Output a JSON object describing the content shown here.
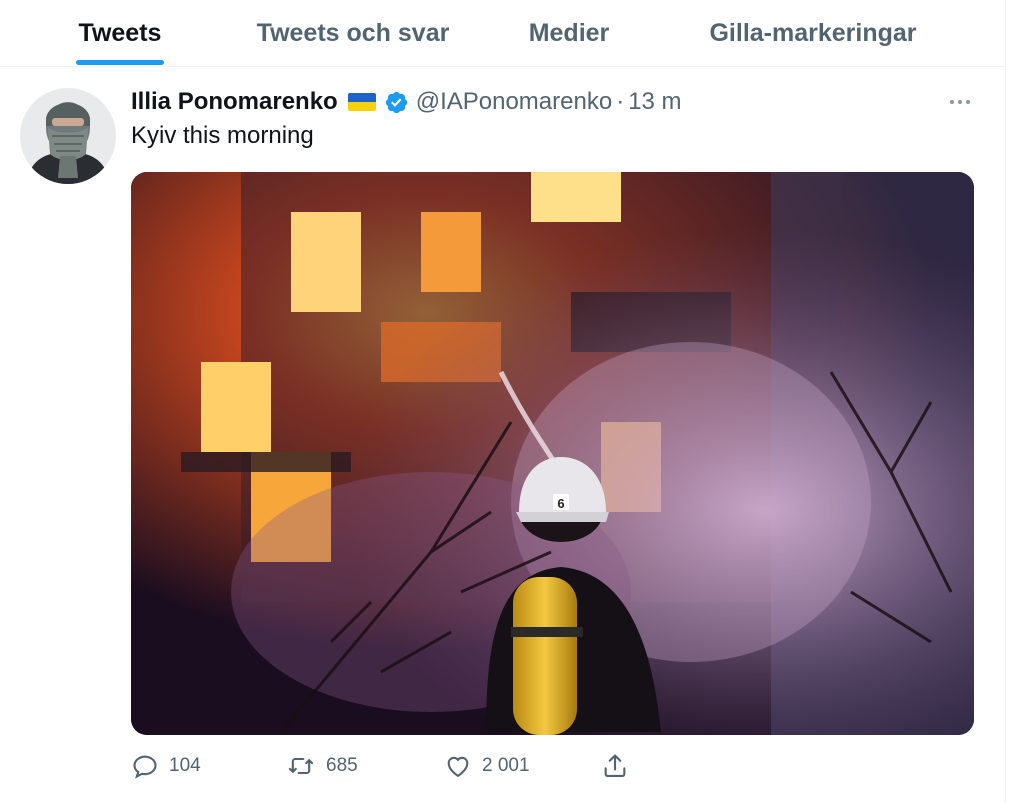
{
  "tabs": [
    {
      "label": "Tweets",
      "active": true
    },
    {
      "label": "Tweets och svar",
      "active": false
    },
    {
      "label": "Medier",
      "active": false
    },
    {
      "label": "Gilla-markeringar",
      "active": false
    }
  ],
  "tweet": {
    "author_name": "Illia Ponomarenko",
    "flag": "ukraine-flag-icon",
    "handle": "@IAPonomarenko",
    "separator": "·",
    "time": "13 m",
    "text": "Kyiv this morning",
    "image_alt": "Firefighter in front of a burning apartment building at night",
    "actions": {
      "replies": "104",
      "retweets": "685",
      "likes": "2 001"
    }
  },
  "colors": {
    "accent": "#1d9bf0",
    "secondary_text": "#536471",
    "primary_text": "#0f1419",
    "border": "#eff3f4"
  },
  "icons": [
    "reply-icon",
    "retweet-icon",
    "like-icon",
    "share-icon",
    "more-icon",
    "verified-badge-icon"
  ]
}
